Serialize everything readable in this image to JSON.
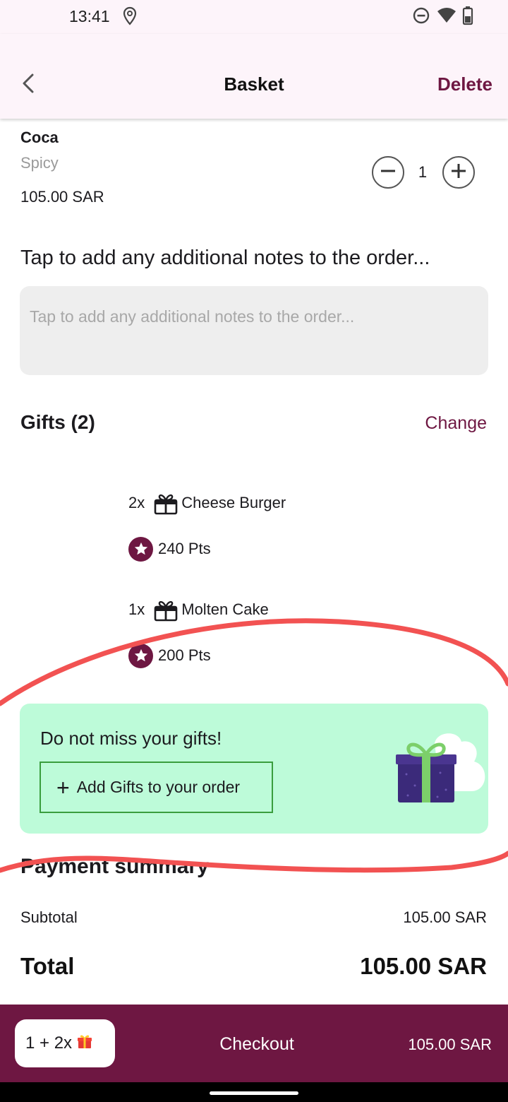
{
  "status_bar": {
    "time": "13:41",
    "icons": [
      "location-pin-icon",
      "do-not-disturb-icon",
      "wifi-icon",
      "battery-icon"
    ]
  },
  "app_bar": {
    "title": "Basket",
    "back_icon": "chevron-left-icon",
    "delete_label": "Delete"
  },
  "item": {
    "name": "Coca",
    "variant": "Spicy",
    "price": "105.00 SAR",
    "quantity": "1"
  },
  "notes": {
    "heading": "Tap to add any additional notes to the order...",
    "placeholder": "Tap to add any additional notes to the order..."
  },
  "gifts": {
    "title": "Gifts (2)",
    "change_label": "Change",
    "items": [
      {
        "qty": "2x",
        "name": "Cheese Burger",
        "points": "240 Pts",
        "icon": "gift-box-icon"
      },
      {
        "qty": "1x",
        "name": "Molten Cake",
        "points": "200 Pts",
        "icon": "gift-box-icon"
      }
    ]
  },
  "promo": {
    "text": "Do not miss your gifts!",
    "button_label": "Add Gifts to your order",
    "image": "gift-illustration"
  },
  "payment": {
    "heading": "Payment summary",
    "subtotal_label": "Subtotal",
    "subtotal_value": "105.00 SAR",
    "total_label": "Total",
    "total_value": "105.00 SAR"
  },
  "checkout": {
    "chip_label": "1 + 2x",
    "label": "Checkout",
    "price": "105.00 SAR"
  },
  "colors": {
    "brand": "#6e1742",
    "promo_bg": "#bdfbd9",
    "promo_border": "#3a9d3e",
    "annotation": "#f05050"
  }
}
